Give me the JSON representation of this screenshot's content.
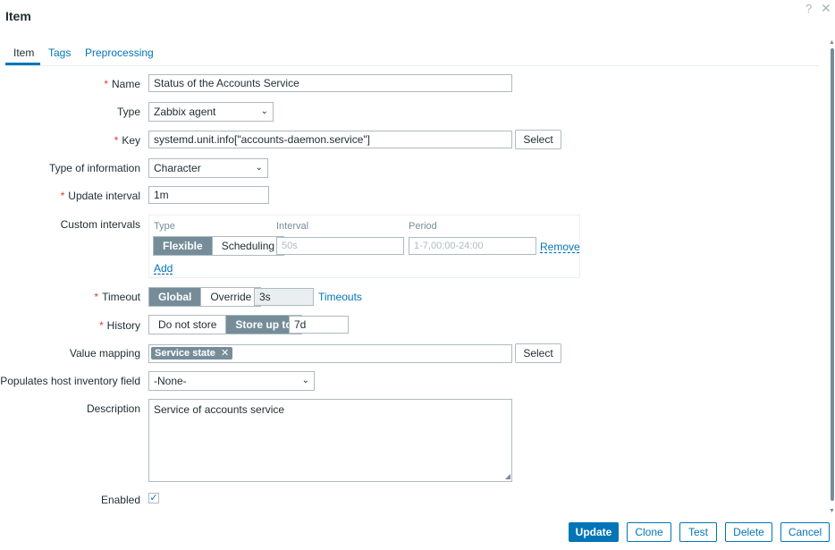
{
  "dialog": {
    "title": "Item",
    "help_icon": "?",
    "close_icon": "✕"
  },
  "tabs": [
    {
      "label": "Item",
      "active": true
    },
    {
      "label": "Tags",
      "active": false
    },
    {
      "label": "Preprocessing",
      "active": false
    }
  ],
  "form": {
    "name": {
      "label": "Name",
      "value": "Status of the Accounts Service"
    },
    "type": {
      "label": "Type",
      "value": "Zabbix agent"
    },
    "key": {
      "label": "Key",
      "value": "systemd.unit.info[\"accounts-daemon.service\"]",
      "select_label": "Select"
    },
    "type_of_information": {
      "label": "Type of information",
      "value": "Character"
    },
    "update_interval": {
      "label": "Update interval",
      "value": "1m"
    },
    "custom_intervals": {
      "label": "Custom intervals",
      "col_type": "Type",
      "col_interval": "Interval",
      "col_period": "Period",
      "mode_flexible": "Flexible",
      "mode_scheduling": "Scheduling",
      "interval_placeholder": "50s",
      "period_placeholder": "1-7,00:00-24:00",
      "remove_label": "Remove",
      "add_label": "Add"
    },
    "timeout": {
      "label": "Timeout",
      "global": "Global",
      "override": "Override",
      "value": "3s",
      "link": "Timeouts"
    },
    "history": {
      "label": "History",
      "do_not_store": "Do not store",
      "store_up_to": "Store up to",
      "value": "7d"
    },
    "value_mapping": {
      "label": "Value mapping",
      "chip": "Service state",
      "chip_remove": "✕",
      "select_label": "Select"
    },
    "inventory": {
      "label": "Populates host inventory field",
      "value": "-None-"
    },
    "description": {
      "label": "Description",
      "value": "Service of accounts service"
    },
    "enabled": {
      "label": "Enabled",
      "checked": true,
      "check_glyph": "✓"
    }
  },
  "footer": {
    "update": "Update",
    "clone": "Clone",
    "test": "Test",
    "delete": "Delete",
    "cancel": "Cancel"
  },
  "colors": {
    "accent": "#0275b8",
    "required": "#e33734",
    "segment_on": "#768d99"
  }
}
